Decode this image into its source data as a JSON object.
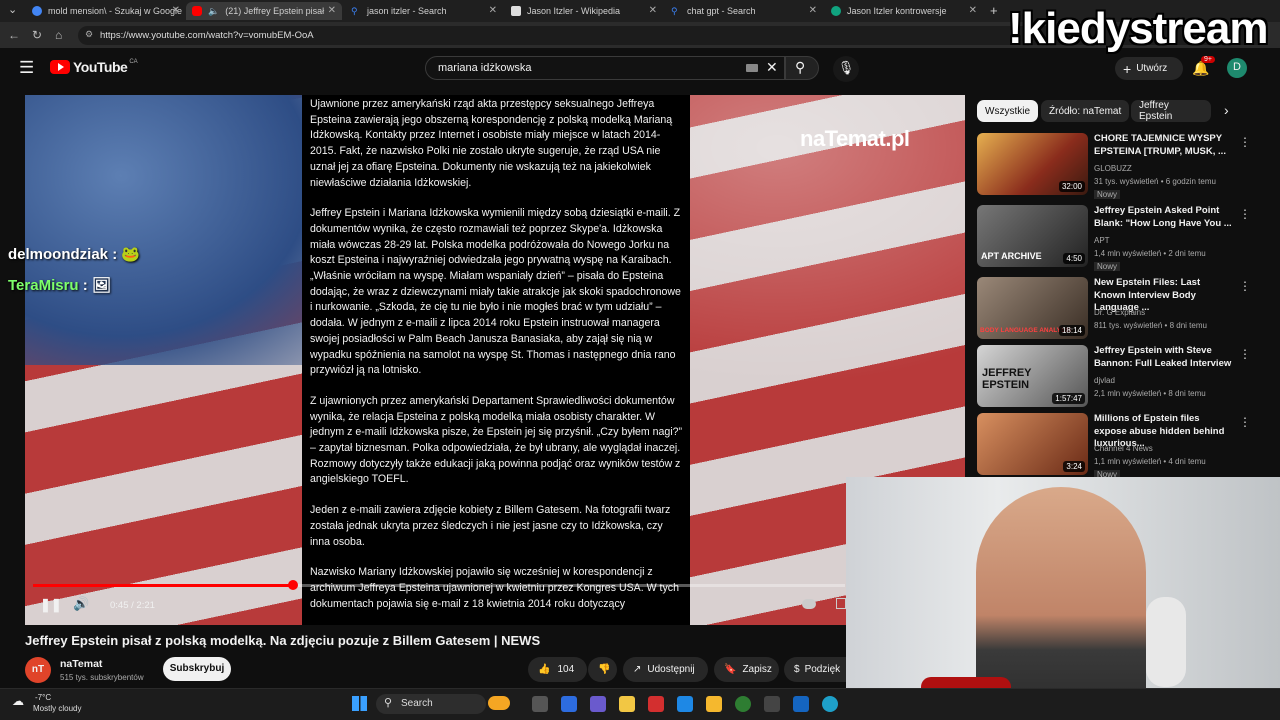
{
  "browser": {
    "tabs": [
      {
        "label": "mold mension\\ - Szukaj w Google",
        "color": "#4285f4"
      },
      {
        "label": "(21) Jeffrey Epstein pisał z p",
        "color": "#ff0000"
      },
      {
        "label": "jason itzler - Search",
        "color": "#3b82f6"
      },
      {
        "label": "Jason Itzler - Wikipedia",
        "color": "#dddddd"
      },
      {
        "label": "chat gpt - Search",
        "color": "#3b82f6"
      },
      {
        "label": "Jason Itzler kontrowersje",
        "color": "#10a37f"
      }
    ],
    "url": "https://www.youtube.com/watch?v=vomubEM-OoA"
  },
  "youtube": {
    "logo": "YouTube",
    "region": "CA",
    "search_value": "mariana idżkowska",
    "create_label": "Utwórz",
    "notif_count": "9+",
    "avatar_letter": "D"
  },
  "video": {
    "watermark": "naTemat.pl",
    "time": "0:45 / 2:21",
    "progress": 0.32,
    "article": [
      "Ujawnione przez amerykański rząd akta przestępcy seksualnego Jeffreya Epsteina zawierają jego obszerną korespondencję z polską modelką Marianą Idżkowską. Kontakty przez Internet i osobiste miały miejsce w latach 2014-2015. Fakt, że nazwisko Polki nie zostało ukryte sugeruje, że rząd USA nie uznał jej za ofiarę Epsteina. Dokumenty nie wskazują też na jakiekolwiek niewłaściwe działania Idżkowskiej.",
      "Jeffrey Epstein i Mariana Idżkowska wymienili między sobą dziesiątki e-maili. Z dokumentów wynika, że często rozmawiali też poprzez Skype'a. Idżkowska miała wówczas 28-29 lat. Polska modelka podróżowała do Nowego Jorku na koszt Epsteina i najwyraźniej odwiedzała jego prywatną wyspę na Karaibach. „Właśnie wróciłam na wyspę. Miałam wspaniały dzień” – pisała do Epsteina dodając, że wraz z dziewczynami miały takie atrakcje jak skoki spadochronowe i nurkowanie. „Szkoda, że cię tu nie było i nie mogłeś brać w tym udziału” – dodała. W jednym z e-maili z lipca 2014 roku Epstein instruował managera swojej posiadłości w Palm Beach Janusza Banasiaka, aby zajął się nią w wypadku spóźnienia na samolot na wyspę St. Thomas i następnego dnia rano przywiózł ją na lotnisko.",
      "Z ujawnionych przez amerykański Departament Sprawiedliwości dokumentów wynika, że relacja Epsteina z polską modelką miała osobisty charakter. W jednym z e-maili Idżkowska pisze, że Epstein jej się przyśnił. „Czy byłem nagi?” – zapytał biznesman. Polka odpowiedziała, że był ubrany, ale wyglądał inaczej. Rozmowy dotyczyły także edukacji jaką powinna podjąć oraz wyników testów z angielskiego TOEFL.",
      "Jeden z e-maili zawiera zdjęcie kobiety z Billem Gatesem. Na fotografii twarz została jednak ukryta przez śledczych i nie jest jasne czy to Idżkowska, czy inna osoba.",
      "Nazwisko Mariany Idżkowskiej pojawiło się wcześniej w korespondencji z archiwum Jeffreya Epsteina ujawnionej w kwietniu przez Kongres USA. W tych dokumentach pojawia się e-mail z 18 kwietnia 2014 roku dotyczący"
    ],
    "title": "Jeffrey Epstein pisał z polską modelką. Na zdjęciu pozuje z Billem Gatesem | NEWS",
    "channel": "naTemat",
    "channel_initials": "nT",
    "subs": "515 tys. subskrybentów",
    "subscribe": "Subskrybuj",
    "likes": "104",
    "share": "Udostępnij",
    "save": "Zapisz",
    "thanks": "Podzięk"
  },
  "chat": [
    {
      "name": "delmoondziak",
      "sep": ":",
      "emote": "🐸"
    },
    {
      "name": "TeraMisru",
      "sep": ":",
      "emote": "🖼"
    }
  ],
  "sidebar": {
    "chips": [
      "Wszystkie",
      "Źródło: naTemat",
      "Jeffrey Epstein"
    ],
    "recs": [
      {
        "title": "CHORE TAJEMNICE WYSPY EPSTEINA [TRUMP, MUSK, ...",
        "channel": "GLOBUZZ",
        "meta": "31 tys. wyświetleń • 6 godzin temu",
        "badge": "Nowy",
        "dur": "32:00",
        "thumb_color": "#8a2c1c"
      },
      {
        "title": "Jeffrey Epstein Asked Point Blank: \"How Long Have You ...",
        "channel": "APT",
        "meta": "1,4 mln wyświetleń • 2 dni temu",
        "badge": "Nowy",
        "dur": "4:50",
        "thumb_color": "#2a2a2a",
        "thumb_text": "APT ARCHIVE"
      },
      {
        "title": "New Epstein Files: Last Known Interview Body Language ...",
        "channel": "Dr. G Explains",
        "meta": "811 tys. wyświetleń • 8 dni temu",
        "badge": "",
        "dur": "18:14",
        "thumb_color": "#55463a",
        "thumb_text": "BODY LANGUAGE ANALYSIS"
      },
      {
        "title": "Jeffrey Epstein with Steve Bannon: Full Leaked Interview",
        "channel": "djvlad",
        "meta": "2,1 mln wyświetleń • 8 dni temu",
        "badge": "",
        "dur": "1:57:47",
        "thumb_color": "#6b6b6b",
        "thumb_text": "JEFFREY EPSTEIN"
      },
      {
        "title": "Millions of Epstein files expose abuse hidden behind luxurious...",
        "channel": "Channel 4 News",
        "meta": "1,1 mln wyświetleń • 4 dni temu",
        "badge": "Nowy",
        "dur": "3:24",
        "thumb_color": "#b7532d"
      }
    ]
  },
  "overlay": {
    "stream_text": "!kiedystream"
  },
  "taskbar": {
    "temp": "-7°C",
    "weather": "Mostly cloudy",
    "search": "Search"
  }
}
